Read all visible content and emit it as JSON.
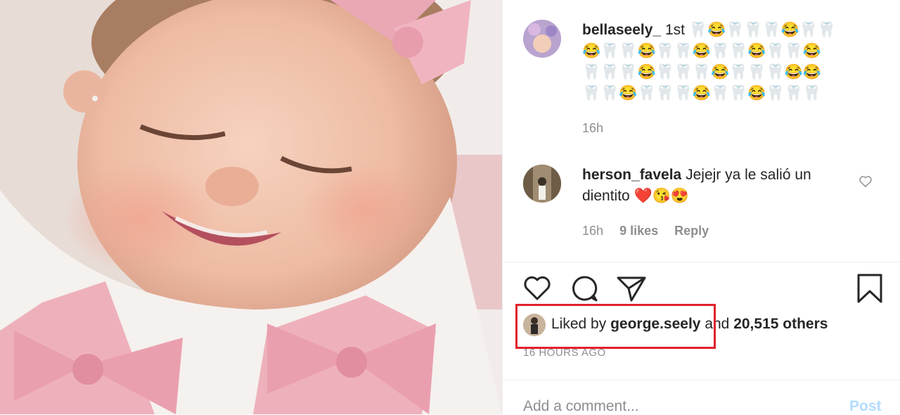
{
  "post": {
    "author": "bellaseely_",
    "caption_prefix": "1st",
    "caption_emoji_lines": [
      "🦷😂🦷🦷🦷😂🦷🦷",
      "😂🦷🦷😂🦷🦷😂🦷🦷😂🦷🦷😂",
      "🦷🦷🦷😂🦷🦷🦷😂🦷🦷🦷😂😂",
      "🦷🦷😂🦷🦷🦷😂🦷🦷😂🦷🦷🦷"
    ],
    "caption_time": "16h"
  },
  "comment": {
    "author": "herson_favela",
    "text": "Jejejr ya le salió un dientito",
    "emojis": "❤️😘😍",
    "time": "16h",
    "likes": "9 likes",
    "reply_label": "Reply"
  },
  "actions": {
    "like_icon": "heart-outline-icon",
    "comment_icon": "comment-bubble-icon",
    "share_icon": "paper-plane-icon",
    "save_icon": "bookmark-icon"
  },
  "likes": {
    "prefix": "Liked by",
    "user": "george.seely",
    "middle": "and",
    "others": "20,515 others"
  },
  "timestamp": "16 HOURS AGO",
  "add_comment": {
    "placeholder": "Add a comment...",
    "post_label": "Post"
  },
  "colors": {
    "highlight": "#e0212c",
    "post_button": "#b3dbff",
    "muted": "#8e8e8e"
  }
}
